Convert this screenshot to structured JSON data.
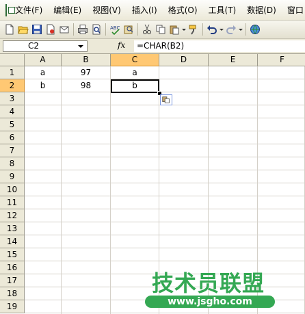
{
  "menu": {
    "items": [
      {
        "label": "文件(F)"
      },
      {
        "label": "编辑(E)"
      },
      {
        "label": "视图(V)"
      },
      {
        "label": "插入(I)"
      },
      {
        "label": "格式(O)"
      },
      {
        "label": "工具(T)"
      },
      {
        "label": "数据(D)"
      },
      {
        "label": "窗口"
      }
    ]
  },
  "toolbar": {
    "icons": [
      "new-icon",
      "open-icon",
      "save-icon",
      "permission-icon",
      "email-icon",
      "print-icon",
      "print-preview-icon",
      "spelling-icon",
      "research-icon",
      "cut-icon",
      "copy-icon",
      "paste-icon",
      "format-painter-icon",
      "undo-icon",
      "redo-icon",
      "hyperlink-icon"
    ]
  },
  "formula_bar": {
    "name_box": "C2",
    "fx_label": "fx",
    "formula": "=CHAR(B2)"
  },
  "sheet": {
    "columns": [
      "A",
      "B",
      "C",
      "D",
      "E",
      "F"
    ],
    "rows": [
      "1",
      "2",
      "3",
      "4",
      "5",
      "6",
      "7",
      "8",
      "9",
      "10",
      "11",
      "12",
      "13",
      "14",
      "15",
      "16",
      "17",
      "18",
      "19"
    ],
    "active_cell": "C2",
    "cells": {
      "A1": "a",
      "B1": "97",
      "C1": "a",
      "A2": "b",
      "B2": "98",
      "C2": "b"
    }
  },
  "watermark": {
    "title": "技术员联盟",
    "url": "www.jsgho.com"
  },
  "colors": {
    "active_header": "#ffc873",
    "watermark_green": "#34a853"
  }
}
